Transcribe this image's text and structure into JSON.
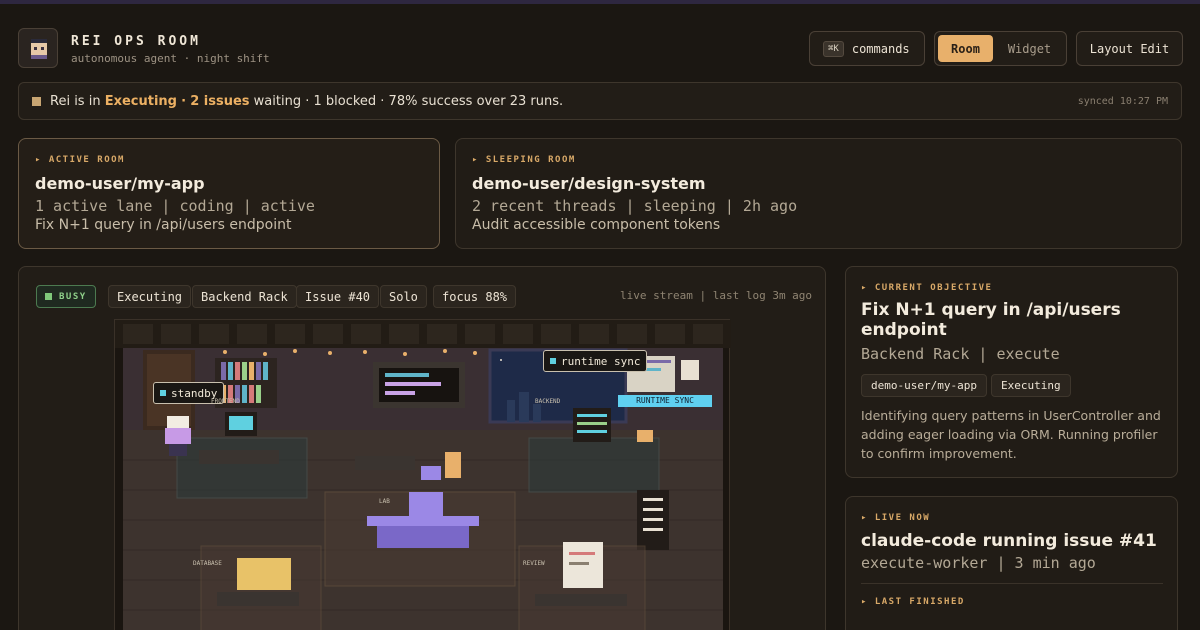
{
  "header": {
    "title": "REI OPS ROOM",
    "subtitle": "autonomous agent · night shift",
    "commands": {
      "kbd": "⌘K",
      "label": "commands"
    },
    "view_toggle": {
      "room": "Room",
      "widget": "Widget"
    },
    "layout_edit": "Layout Edit"
  },
  "status": {
    "prefix": "Rei is in",
    "state": "Executing",
    "sep": "·",
    "issues": "2 issues",
    "rest": "waiting · 1 blocked · 78% success over 23 runs.",
    "synced": "synced 10:27 PM"
  },
  "rooms": [
    {
      "eyebrow": "ACTIVE ROOM",
      "name": "demo-user/my-app",
      "meta": "1 active lane | coding | active",
      "task": "Fix N+1 query in /api/users endpoint"
    },
    {
      "eyebrow": "SLEEPING ROOM",
      "name": "demo-user/design-system",
      "meta": "2 recent threads | sleeping | 2h ago",
      "task": "Audit accessible component tokens"
    }
  ],
  "stage": {
    "badge": "BUSY",
    "tags": [
      "Executing",
      "Backend Rack",
      "Issue #40",
      "Solo",
      "focus 88%"
    ],
    "stream": "live stream | last log 3m ago",
    "scene": {
      "bubble_agent": "standby",
      "bubble_sync": "runtime sync",
      "screen_label": "RUNTIME SYNC",
      "stations": {
        "frontend": "FRONTEND",
        "backend": "BACKEND",
        "database": "DATABASE",
        "review": "REVIEW",
        "lab": "LAB"
      }
    }
  },
  "objective": {
    "eyebrow": "CURRENT OBJECTIVE",
    "title": "Fix N+1 query in /api/users endpoint",
    "meta": "Backend Rack | execute",
    "chips": [
      "demo-user/my-app",
      "Executing"
    ],
    "desc": "Identifying query patterns in UserController and adding eager loading via ORM. Running profiler to confirm improvement."
  },
  "live": {
    "eyebrow": "LIVE NOW",
    "title": "claude-code running issue #41",
    "meta": "execute-worker | 3 min ago",
    "last_eyebrow": "LAST FINISHED"
  },
  "colors": {
    "accent": "#e8b06b",
    "busy": "#7fc97a",
    "bg": "#1b1712"
  }
}
